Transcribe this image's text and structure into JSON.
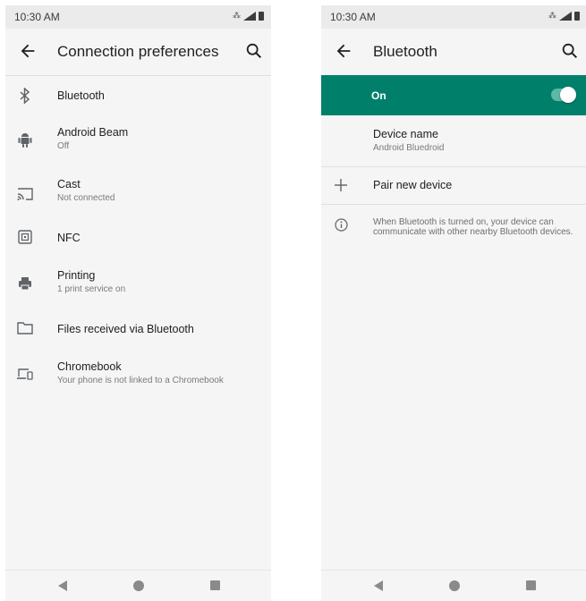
{
  "left": {
    "status": {
      "time": "10:30 AM"
    },
    "title": "Connection preferences",
    "items": [
      {
        "title": "Bluetooth",
        "subtitle": "",
        "icon": "bluetooth-icon"
      },
      {
        "title": "Android Beam",
        "subtitle": "Off",
        "icon": "android-icon"
      },
      {
        "title": "Cast",
        "subtitle": "Not connected",
        "icon": "cast-icon"
      },
      {
        "title": "NFC",
        "subtitle": "",
        "icon": "nfc-icon"
      },
      {
        "title": "Printing",
        "subtitle": "1 print service on",
        "icon": "printer-icon"
      },
      {
        "title": "Files received via Bluetooth",
        "subtitle": "",
        "icon": "folder-icon"
      },
      {
        "title": "Chromebook",
        "subtitle": "Your phone is not linked to a Chromebook",
        "icon": "devices-icon"
      }
    ]
  },
  "right": {
    "status": {
      "time": "10:30 AM"
    },
    "title": "Bluetooth",
    "toggle": {
      "label": "On",
      "state": true,
      "color": "#00806b"
    },
    "device_name": {
      "title": "Device name",
      "value": "Android Bluedroid"
    },
    "pair": {
      "label": "Pair new device",
      "icon": "plus-icon"
    },
    "info": {
      "text": "When Bluetooth is turned on, your device can communicate with other nearby Bluetooth devices.",
      "icon": "info-icon"
    }
  }
}
